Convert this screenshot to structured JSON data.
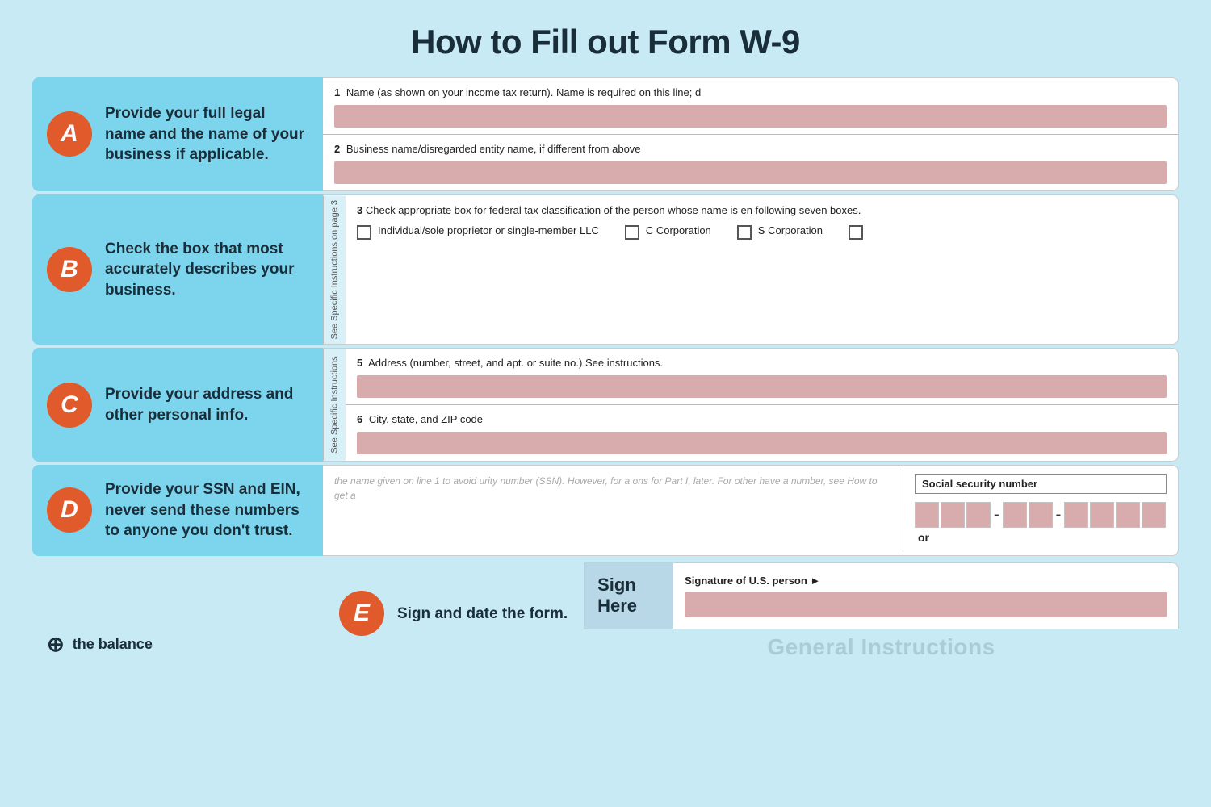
{
  "page": {
    "title": "How to Fill out Form W-9",
    "background_color": "#c8eaf5"
  },
  "brand": {
    "icon": "⊕",
    "name": "the balance"
  },
  "rows": [
    {
      "id": "A",
      "badge": "A",
      "instruction": "Provide your full legal name and the name of your business if applicable.",
      "fields": [
        {
          "num": "1",
          "label": "Name (as shown on your income tax return). Name is required on this line; d",
          "has_input": true
        },
        {
          "num": "2",
          "label": "Business name/disregarded entity name, if different from above",
          "has_input": true
        }
      ]
    },
    {
      "id": "B",
      "badge": "B",
      "instruction": "Check the box that most accurately describes your business.",
      "side_text": "See Specific Instructions on page 3",
      "field_num": "3",
      "field_label": "Check appropriate box for federal tax classification of the person whose name is en following seven boxes.",
      "checkboxes": [
        "Individual/sole proprietor or single-member LLC",
        "C Corporation",
        "S Corporation"
      ]
    },
    {
      "id": "C",
      "badge": "C",
      "instruction": "Provide your address and other personal info.",
      "side_text": "See Specific Instructions",
      "fields": [
        {
          "num": "5",
          "label": "Address (number, street, and apt. or suite no.) See instructions.",
          "has_input": true
        },
        {
          "num": "6",
          "label": "City, state, and ZIP code",
          "has_input": true
        }
      ]
    },
    {
      "id": "D",
      "badge": "D",
      "instruction": "Provide your SSN and EIN, never send these numbers to anyone you don't trust.",
      "ssn_placeholder_text": "the name given on line 1 to avoid urity number (SSN). However, for a ons for Part I, later. For other have a number, see How to get a",
      "ssn_label": "Social security number",
      "ssn_or": "or"
    },
    {
      "id": "E",
      "badge": "E",
      "instruction": "Sign and date the form.",
      "sign_here": "Sign\nHere",
      "signature_label": "Signature of U.S. person ►",
      "general_instructions": "General Instructions"
    }
  ]
}
